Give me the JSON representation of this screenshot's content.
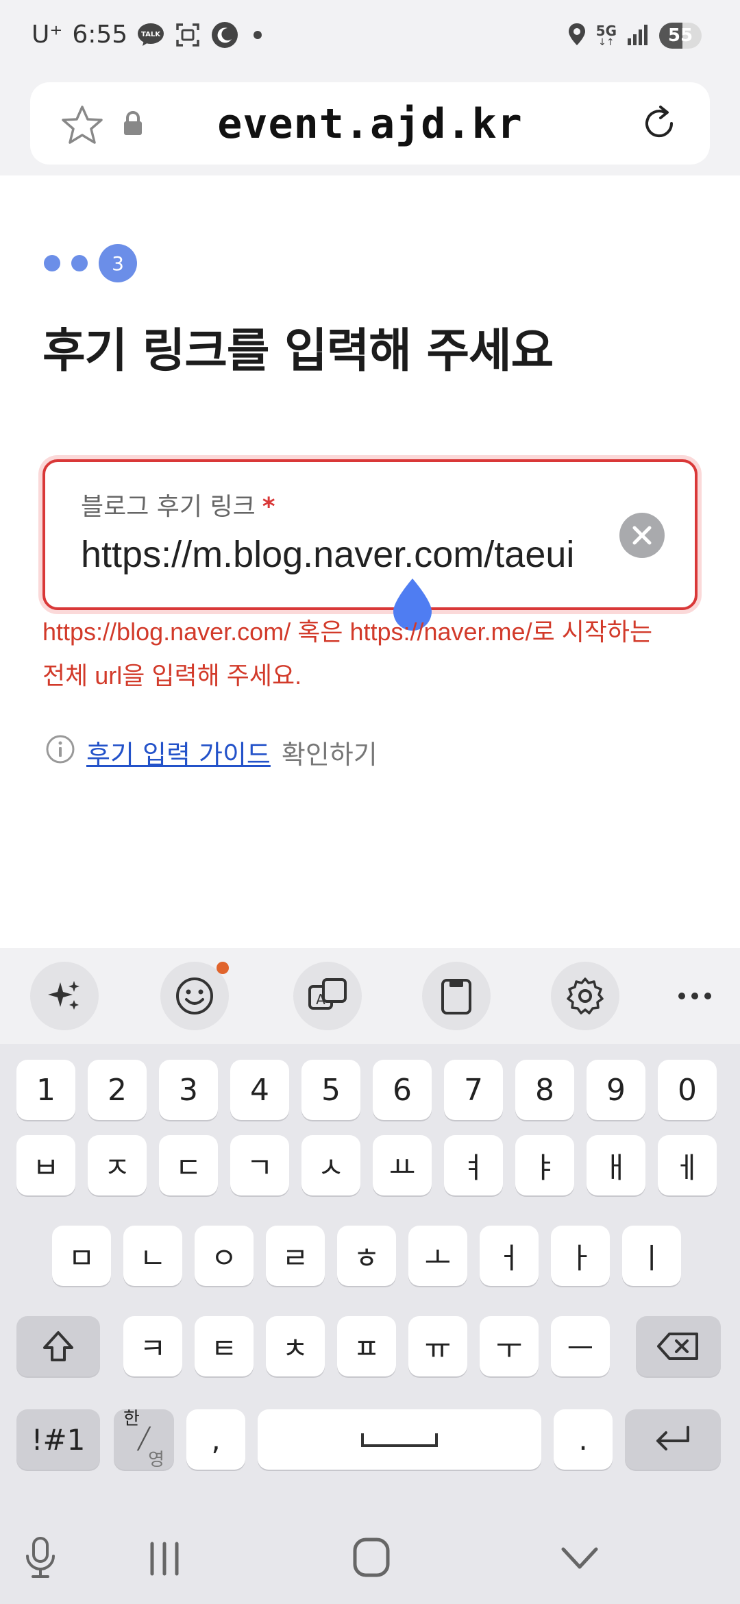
{
  "status_bar": {
    "carrier": "U⁺",
    "time": "6:55",
    "network": "5G",
    "battery": "55",
    "battery_level": 0.55
  },
  "browser": {
    "url": "event.ajd.kr",
    "icons": [
      "star-icon",
      "lock-icon",
      "reload-icon"
    ]
  },
  "steps": {
    "current": "3",
    "total_dots_before": 2
  },
  "page": {
    "title": "후기 링크를 입력해 주세요",
    "field_label": "블로그 후기 링크",
    "required_mark": "*",
    "field_value": "https://m.blog.naver.com/taeui",
    "error_line1": "https://blog.naver.com/ 혹은 https://naver.me/로 시작하는",
    "error_line2": "전체 url을 입력해 주세요.",
    "guide_link": "후기 입력 가이드",
    "guide_rest": "확인하기"
  },
  "keyboard": {
    "toolbar": [
      "sparkle-icon",
      "emoji-icon",
      "translate-icon",
      "clipboard-icon",
      "settings-icon",
      "more-icon"
    ],
    "row_numbers": [
      "1",
      "2",
      "3",
      "4",
      "5",
      "6",
      "7",
      "8",
      "9",
      "0"
    ],
    "row1": [
      "ㅂ",
      "ㅈ",
      "ㄷ",
      "ㄱ",
      "ㅅ",
      "ㅛ",
      "ㅕ",
      "ㅑ",
      "ㅐ",
      "ㅔ"
    ],
    "row2": [
      "ㅁ",
      "ㄴ",
      "ㅇ",
      "ㄹ",
      "ㅎ",
      "ㅗ",
      "ㅓ",
      "ㅏ",
      "ㅣ"
    ],
    "row3": [
      "ㅋ",
      "ㅌ",
      "ㅊ",
      "ㅍ",
      "ㅠ",
      "ㅜ",
      "ㅡ"
    ],
    "symbols_key": "!#1",
    "lang_key_top": "한",
    "lang_key_bottom": "영",
    "comma": ",",
    "period": "."
  },
  "colors": {
    "accent": "#6b8ee8",
    "error": "#d93838",
    "link": "#2352c9"
  }
}
